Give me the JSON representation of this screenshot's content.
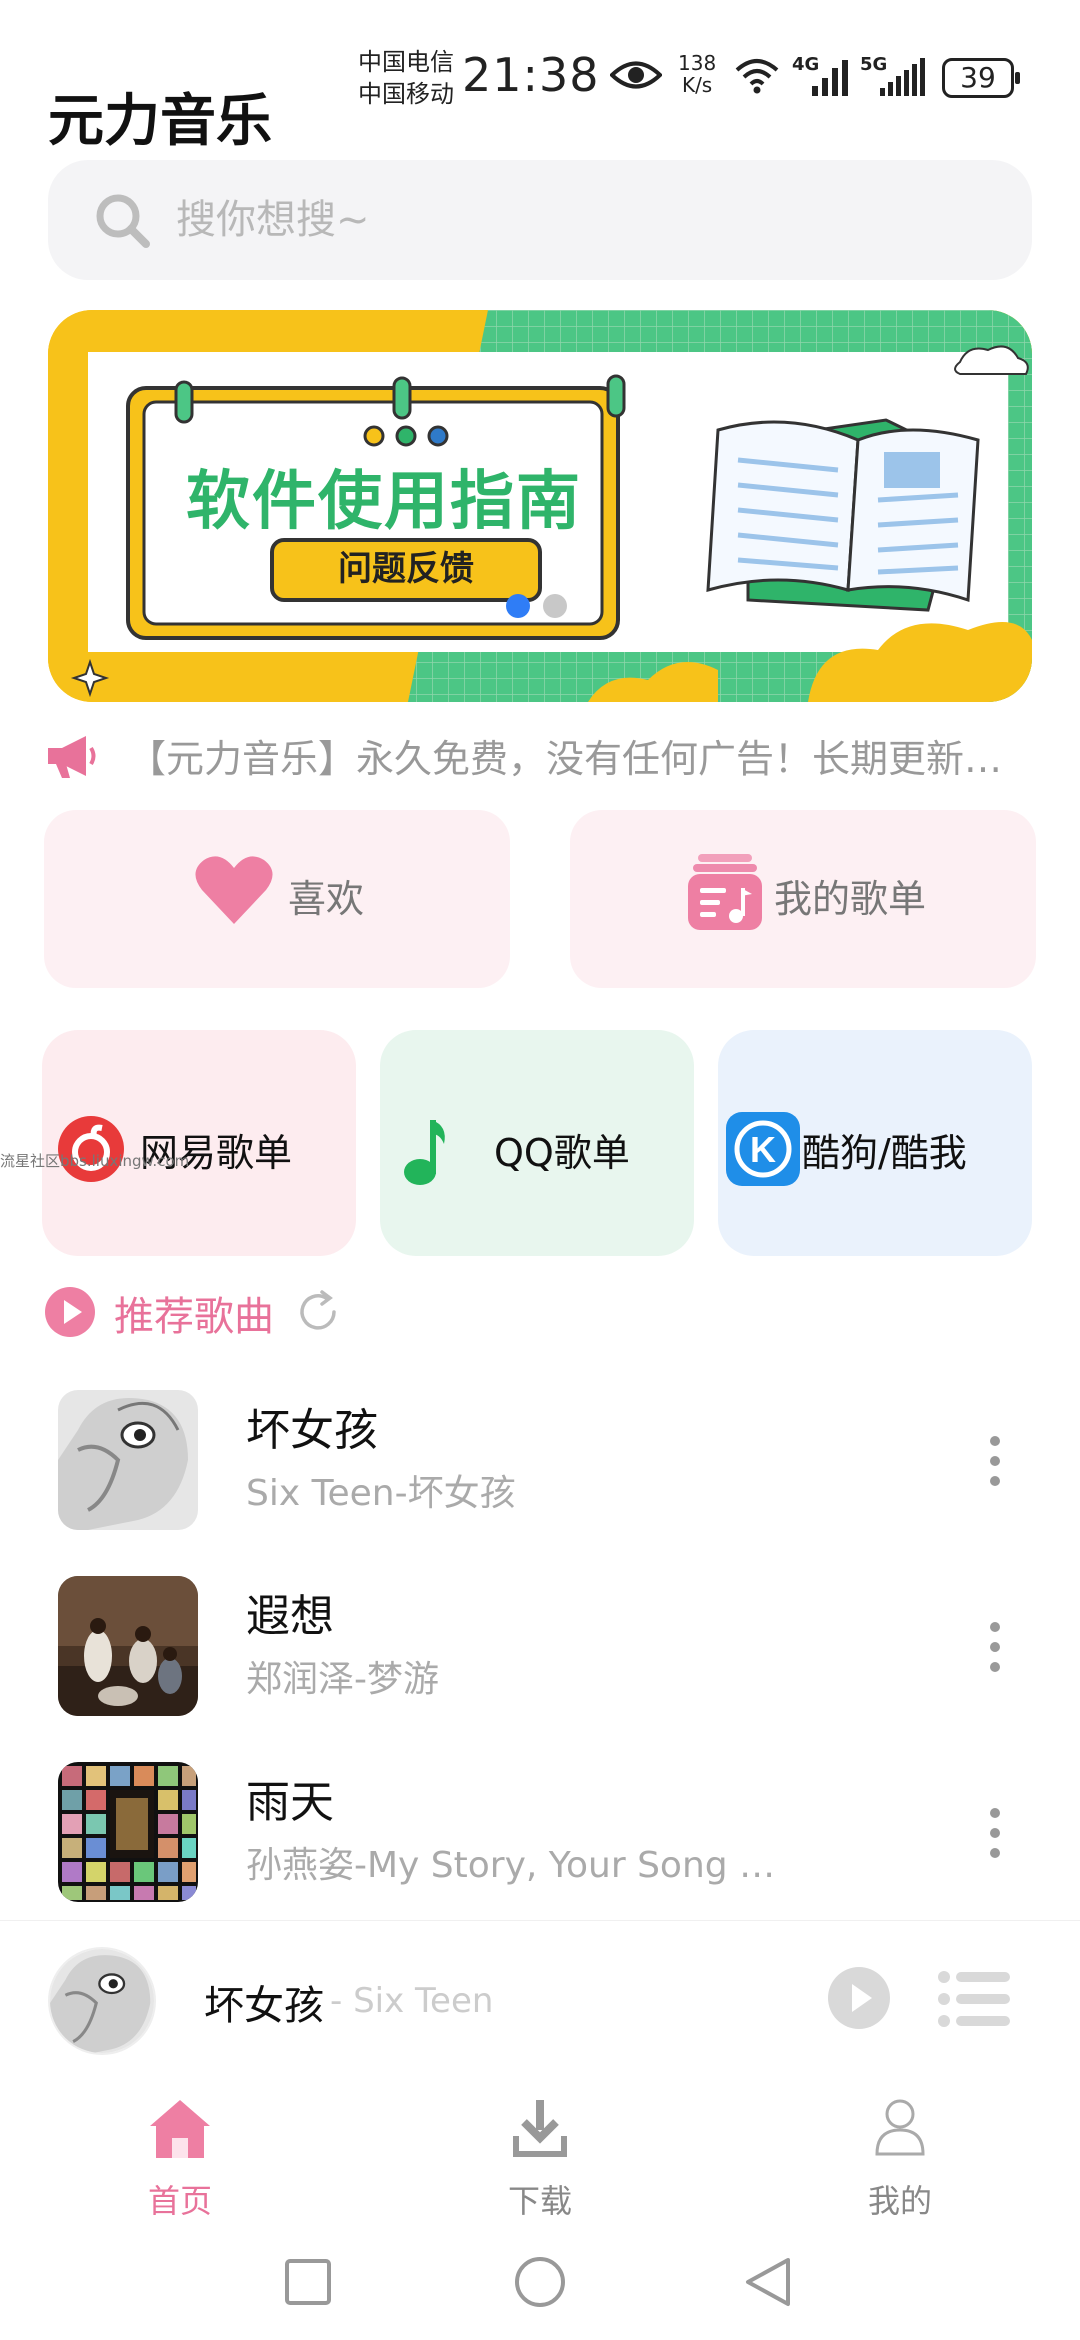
{
  "status_bar": {
    "carrier_1": "中国电信",
    "carrier_2": "中国移动",
    "time": "21:38",
    "net_speed_value": "138",
    "net_speed_unit": "K/s",
    "signal_1": "4G",
    "signal_2": "5G",
    "battery": "39"
  },
  "app": {
    "title": "元力音乐"
  },
  "search": {
    "placeholder": "搜你想搜~"
  },
  "banner": {
    "title": "软件使用指南",
    "button": "问题反馈",
    "page_count": 2,
    "active_page": 1
  },
  "notice": {
    "text": "【元力音乐】永久免费，没有任何广告！长期更新维护"
  },
  "quick": {
    "like": "喜欢",
    "my_playlist": "我的歌单"
  },
  "sources": [
    {
      "label": "网易歌单",
      "bg": "#fdecef"
    },
    {
      "label": "QQ歌单",
      "bg": "#e8f6ee"
    },
    {
      "label": "酷狗/酷我",
      "bg": "#eaf2fc"
    }
  ],
  "watermark": "流星社区bbs.liuxingw.com",
  "recommend": {
    "title": "推荐歌曲"
  },
  "songs": [
    {
      "title": "坏女孩",
      "subtitle": "Six Teen-坏女孩"
    },
    {
      "title": "遐想",
      "subtitle": "郑润泽-梦游"
    },
    {
      "title": "雨天",
      "subtitle": "孙燕姿-My Story, Your Song 经典全纪录"
    }
  ],
  "player": {
    "title": "坏女孩",
    "artist": "- Six Teen"
  },
  "tabs": [
    {
      "label": "首页",
      "active": true
    },
    {
      "label": "下载",
      "active": false
    },
    {
      "label": "我的",
      "active": false
    }
  ],
  "colors": {
    "accent": "#e8729a",
    "inactive": "#999999"
  }
}
